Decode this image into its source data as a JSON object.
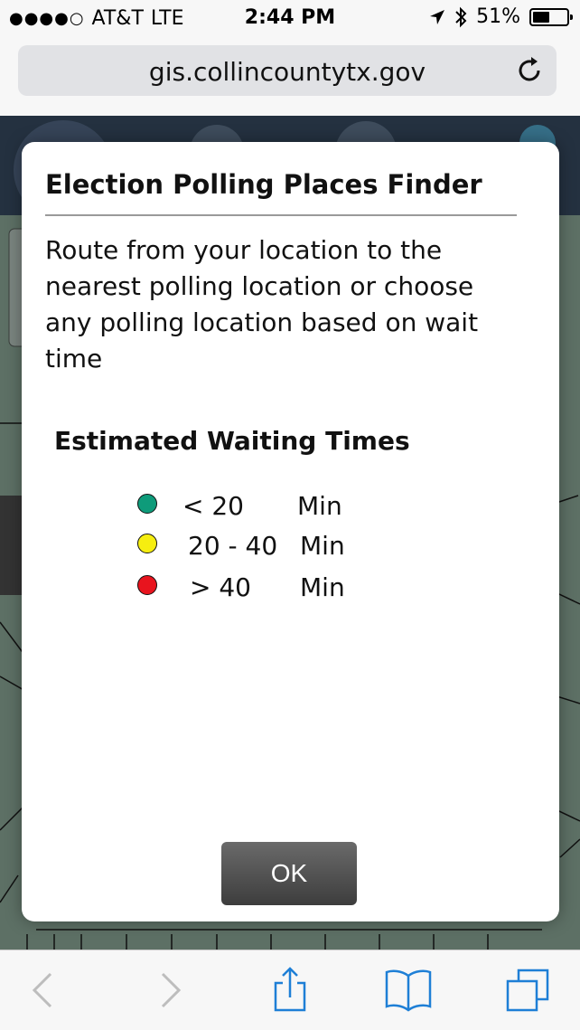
{
  "status": {
    "carrier": "AT&T",
    "network": "LTE",
    "time": "2:44 PM",
    "battery": "51%",
    "battery_level": 0.51,
    "signal_bars": 4
  },
  "browser": {
    "url": "gis.collincountytx.gov"
  },
  "modal": {
    "title": "Election Polling Places Finder",
    "description": "Route from your location to the nearest polling location or choose any polling location based on wait time",
    "legend": {
      "title": "Estimated Waiting Times",
      "items": [
        {
          "range": "< 20",
          "unit": "Min",
          "color": "#0e9b7a"
        },
        {
          "range": "20 - 40",
          "unit": "Min",
          "color": "#f6ee10"
        },
        {
          "range": "> 40",
          "unit": "Min",
          "color": "#e8141e"
        }
      ]
    },
    "ok_label": "OK"
  },
  "colors": {
    "accent": "#1e7fd6",
    "map_bg": "#2f3b38"
  },
  "icons": {
    "back": "chevron-left-icon",
    "forward": "chevron-right-icon",
    "share": "share-icon",
    "bookmarks": "book-icon",
    "tabs": "tabs-icon",
    "reload": "reload-icon"
  }
}
